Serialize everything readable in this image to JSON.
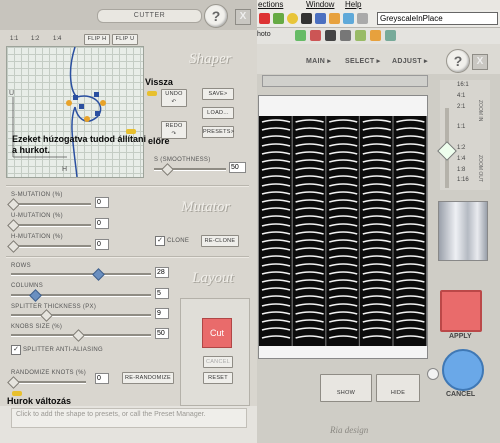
{
  "host": {
    "menu": [
      "ections",
      "Window",
      "Help"
    ],
    "mode_select": "GreyscaleInPlace",
    "toolbar2_label": "hoto"
  },
  "cutter": {
    "title": "CUTTER",
    "help_label": "?",
    "close_label": "X",
    "shaper": {
      "title": "Shaper",
      "tabs": [
        "1:1",
        "1:2",
        "1:4"
      ],
      "flip_h": "FLIP H",
      "flip_u": "FLIP U",
      "axis_u": "U",
      "axis_h": "H",
      "annotation_back": "Vissza",
      "annotation_forward": "előre",
      "annotation_drag": "Ezeket húzogatva tudod állítani a hurkot.",
      "undo": "UNDO",
      "redo": "REDO",
      "save": "SAVE>",
      "load": "LOAD...",
      "presets": "PRESETS>",
      "smoothness_label": "S (SMOOTHNESS)",
      "smoothness_value": "50",
      "smoothness_level": 0.18
    },
    "mutator": {
      "title": "Mutator",
      "s_label": "S-MUTATION (%)",
      "s_value": "0",
      "u_label": "U-MUTATION (%)",
      "u_value": "0",
      "h_label": "H-MUTATION (%)",
      "h_value": "0",
      "clone_label": "CLONE",
      "reclone": "RE-CLONE"
    },
    "layout": {
      "title": "Layout",
      "rows_label": "ROWS",
      "rows_value": "28",
      "columns_label": "COLUMNS",
      "columns_value": "5",
      "thickness_label": "SPLITTER THICKNESS (PX)",
      "thickness_value": "9",
      "knobs_label": "KNOBS SIZE (%)",
      "knobs_value": "50",
      "antialias_label": "SPLITTER ANTI-ALIASING",
      "randomize_label": "RANDOMIZE KNOTS (%)",
      "randomize_value": "0",
      "rerandomize": "RE-RANDOMIZE",
      "annotation_knots": "Hurok változás"
    },
    "cut": "Cut",
    "cancel": "CANCEL",
    "reset": "RESET",
    "status": "Click to add the shape to presets, or call the Preset Manager."
  },
  "preview": {
    "tabs": [
      "MAIN ▸",
      "SELECT ▸",
      "ADJUST ▸"
    ],
    "zoom_levels": [
      "16:1",
      "4:1",
      "2:1",
      "1:1",
      "1:2",
      "1:4",
      "1:8",
      "1:16"
    ],
    "zoom_in": "ZOOM IN",
    "zoom_out": "ZOOM OUT",
    "apply": "APPLY",
    "cancel": "CANCEL",
    "show": "SHOW",
    "hide": "HIDE",
    "signature": "Ria design"
  },
  "colors": {
    "cut_button": "#e96b6b",
    "apply_button": "#e96b6b",
    "cancel_button": "#6aa8e8",
    "annotation_arrow": "#e8c02e"
  }
}
